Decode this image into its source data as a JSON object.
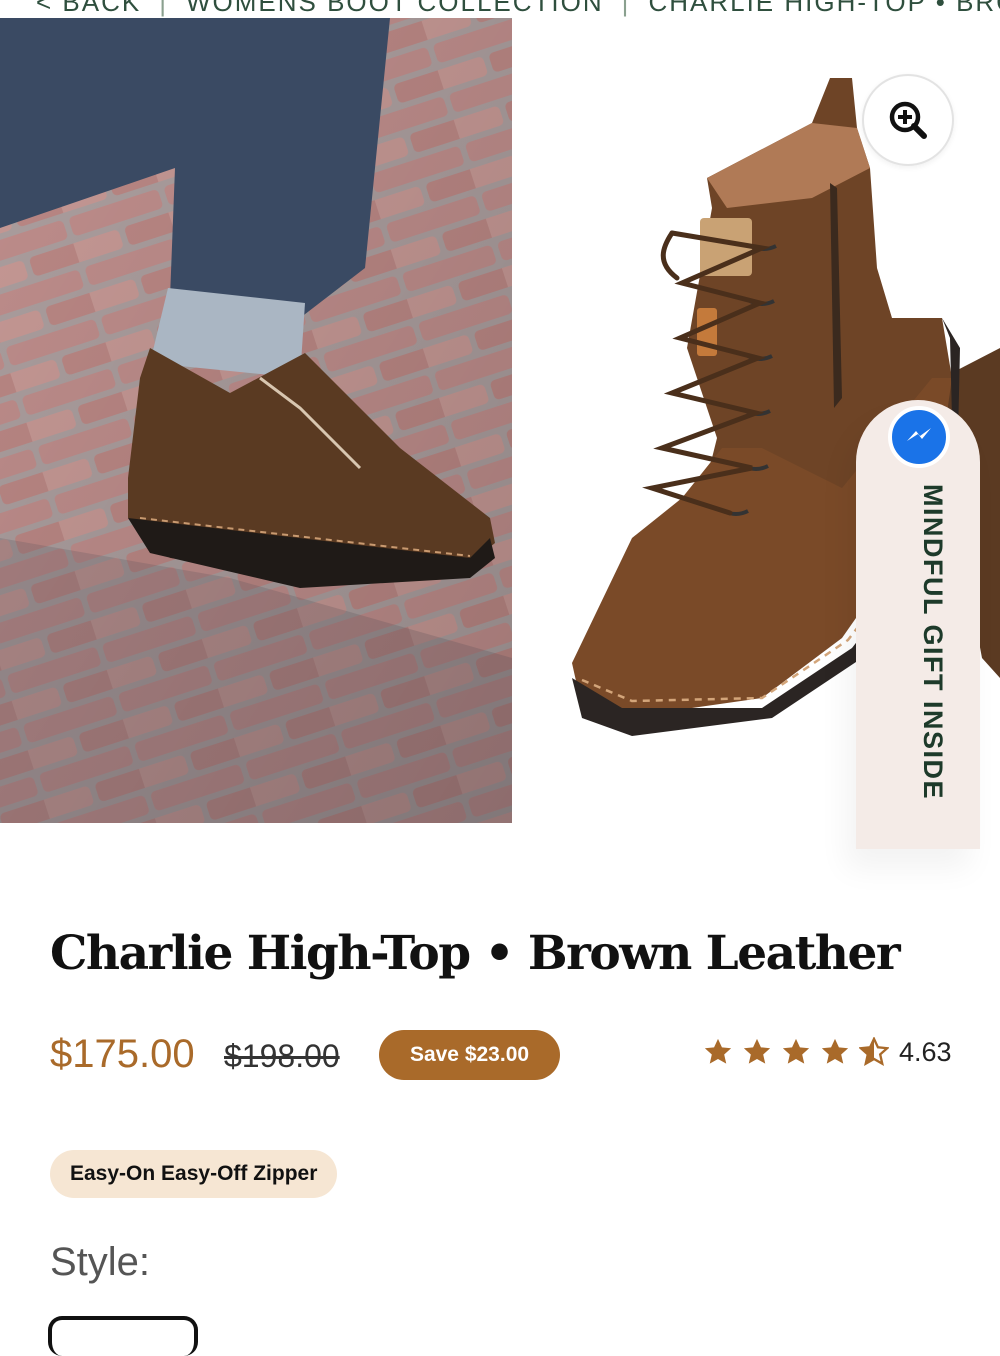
{
  "breadcrumb": {
    "back": "< BACK",
    "collection": "WOMENS BOOT COLLECTION",
    "current": "CHARLIE HIGH-TOP • BROWN LEA..."
  },
  "gallery": {
    "zoom_icon": "zoom-in-icon",
    "gift_tab": {
      "icon": "messenger-icon",
      "label": "MINDFUL GIFT INSIDE"
    }
  },
  "product": {
    "title": "Charlie High-Top • Brown Leather",
    "price": "$175.00",
    "compare_price": "$198.00",
    "save_label": "Save $23.00",
    "rating": {
      "value": 4.63,
      "display": "4.63",
      "max": 5,
      "star_icon": "star-icon"
    },
    "feature_chip": "Easy-On Easy-Off Zipper",
    "style_label": "Style:"
  },
  "colors": {
    "accent": "#a96a2a",
    "breadcrumb": "#2f4f3e",
    "chip_bg": "#f6e6d3",
    "gift_tab_bg": "#f4ebe7",
    "messenger_blue": "#1a73e8"
  }
}
